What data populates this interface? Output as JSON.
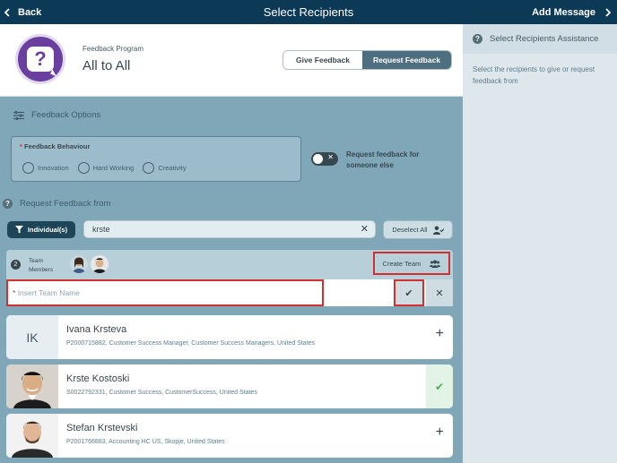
{
  "topbar": {
    "back_label": "Back",
    "title": "Select Recipients",
    "add_message_label": "Add Message"
  },
  "program": {
    "label": "Feedback Program",
    "name": "All to All",
    "tabs": [
      {
        "label": "Give Feedback",
        "active": false
      },
      {
        "label": "Request Feedback",
        "active": true
      }
    ]
  },
  "feedback_options": {
    "heading": "Feedback Options",
    "behaviour_label": "Feedback Behaviour",
    "behaviours": [
      "Innovation",
      "Hard Working",
      "Creativity"
    ],
    "toggle_label": "Request feedback for someone else",
    "toggle_on": false
  },
  "request_from": {
    "heading": "Request Feedback from",
    "filter_label": "Individual(s)",
    "search_value": "krste",
    "deselect_label": "Deselect All"
  },
  "team": {
    "count": "2",
    "members_label_line1": "Team",
    "members_label_line2": "Members",
    "create_team_label": "Create Team",
    "name_placeholder": "Insert Team Name"
  },
  "people": [
    {
      "initials": "IK",
      "name": "Ivana Krsteva",
      "meta": "P2000715882, Customer Success Manager, Customer Success Managers, United States",
      "selected": false
    },
    {
      "initials": "",
      "name": "Krste Kostoski",
      "meta": "S0022792331, Customer Success, CustomerSuccess, United States",
      "selected": true
    },
    {
      "initials": "",
      "name": "Stefan Krstevski",
      "meta": "P2001766883, Accounting HC US, Skopje, United States",
      "selected": false
    }
  ],
  "assistance": {
    "title": "Select Recipients Assistance",
    "text": "Select the recipients to give or request feedback from"
  },
  "colors": {
    "topbar": "#0c3956",
    "panel": "#7fa7b8",
    "accent": "#4d6f80",
    "highlight": "#d32f2f"
  }
}
